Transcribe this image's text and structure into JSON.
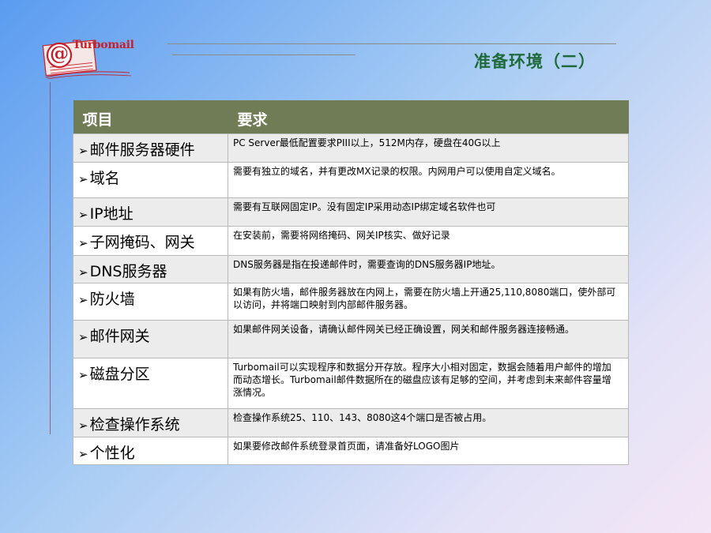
{
  "brand": {
    "logo_text": "Turbomail",
    "logo_symbol": "@"
  },
  "title": "准备环境（二）",
  "table": {
    "headers": [
      "项目",
      "要求"
    ],
    "rows": [
      {
        "item": "邮件服务器硬件",
        "req": "PC Server最低配置要求PIII以上，512M内存，硬盘在40G以上"
      },
      {
        "item": "域名",
        "req": "需要有独立的域名，并有更改MX记录的权限。内网用户可以使用自定义域名。"
      },
      {
        "item": "IP地址",
        "req": "需要有互联网固定IP。没有固定IP采用动态IP绑定域名软件也可"
      },
      {
        "item": "子网掩码、网关",
        "req": "在安装前，需要将网络掩码、网关IP核实、做好记录"
      },
      {
        "item": "DNS服务器",
        "req": "DNS服务器是指在投递邮件时，需要查询的DNS服务器IP地址。"
      },
      {
        "item": "防火墙",
        "req": "如果有防火墙，邮件服务器放在内网上，需要在防火墙上开通25,110,8080端口，使外部可以访问，并将端口映射到内部邮件服务器。"
      },
      {
        "item": "邮件网关",
        "req": "如果邮件网关设备，请确认邮件网关已经正确设置，网关和邮件服务器连接畅通。"
      },
      {
        "item": "磁盘分区",
        "req": "Turbomail可以实现程序和数据分开存放。程序大小相对固定，数据会随着用户邮件的增加而动态增长。Turbomail邮件数据所在的磁盘应该有足够的空间，并考虑到未来邮件容量增涨情况。"
      },
      {
        "item": "检查操作系统",
        "req": "检查操作系统25、110、143、8080这4个端口是否被占用。"
      },
      {
        "item": "个性化",
        "req": "如果要修改邮件系统登录首页面，请准备好LOGO图片"
      }
    ]
  },
  "icons": {
    "bullet": "arrow-bullet-icon",
    "logo": "mail-envelope-icon"
  },
  "colors": {
    "header_bg": "#6f7c56",
    "title": "#1f6a3a",
    "logo": "#c8202a"
  }
}
